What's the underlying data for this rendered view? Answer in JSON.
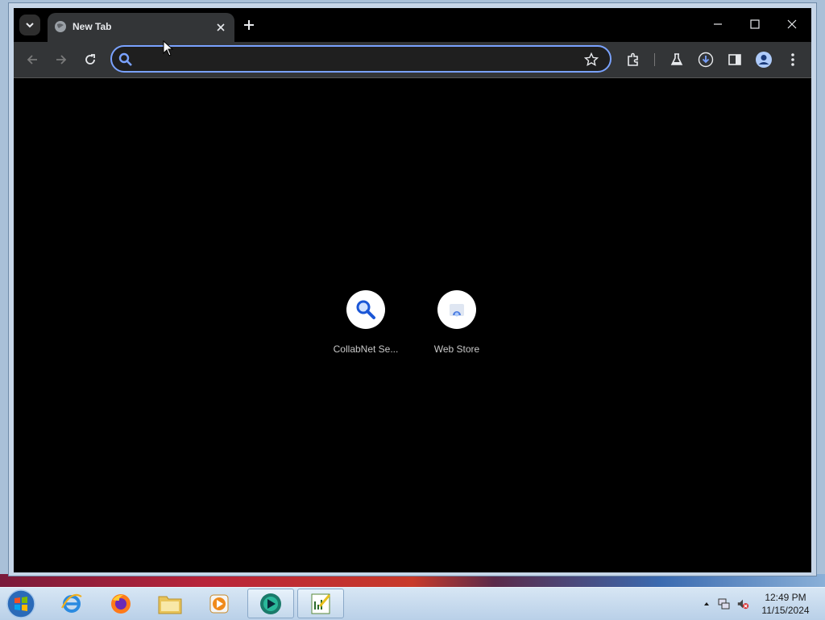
{
  "browser": {
    "tab": {
      "title": "New Tab"
    },
    "omnibox": {
      "value": "",
      "placeholder": ""
    }
  },
  "new_tab_page": {
    "shortcuts": [
      {
        "label": "CollabNet Se...",
        "icon": "search-icon"
      },
      {
        "label": "Web Store",
        "icon": "web-store-icon"
      }
    ]
  },
  "taskbar": {
    "items": [
      "start-orb",
      "internet-explorer-icon",
      "firefox-icon",
      "file-explorer-icon",
      "media-player-icon",
      "browser-app-icon",
      "spreadsheet-app-icon"
    ],
    "clock": {
      "time": "12:49 PM",
      "date": "11/15/2024"
    }
  },
  "colors": {
    "accent": "#7aa2ff",
    "toolbar": "#333537",
    "page_background": "#000000"
  }
}
